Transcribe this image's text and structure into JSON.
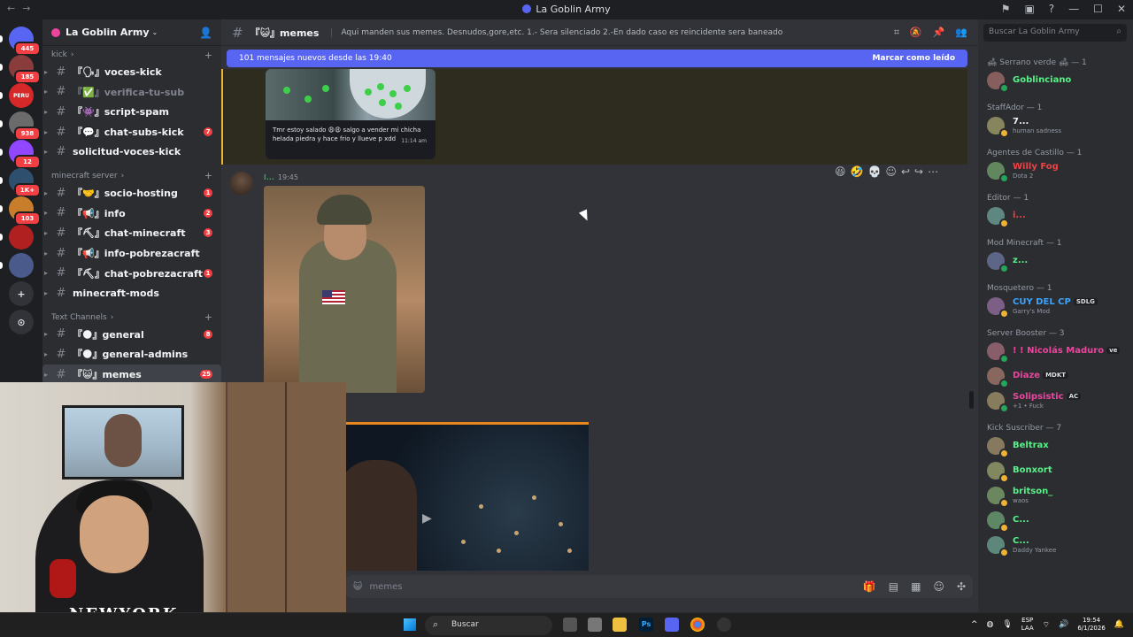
{
  "titlebar": {
    "title": "La Goblin Army",
    "back": "←",
    "forward": "→"
  },
  "guilds": [
    {
      "label": "",
      "badge": "445",
      "color": "#5865f2"
    },
    {
      "label": "",
      "badge": "185",
      "color": "#8a3b3b"
    },
    {
      "label": "PERU",
      "badge": "",
      "color": "#d62828"
    },
    {
      "label": "",
      "badge": "938",
      "color": "#6b6b6b"
    },
    {
      "label": "",
      "badge": "12",
      "color": "#9146ff"
    },
    {
      "label": "",
      "badge": "1K+",
      "color": "#2f4f6f"
    },
    {
      "label": "",
      "badge": "103",
      "color": "#c77d2a"
    },
    {
      "label": "",
      "badge": "",
      "color": "#b02020"
    },
    {
      "label": "",
      "badge": "",
      "color": "#4a5a8a"
    }
  ],
  "server": {
    "name": "La Goblin Army",
    "categories": [
      {
        "name": "kick",
        "channels": [
          {
            "label": "『🗣』voces-kick",
            "count": "",
            "muted": false
          },
          {
            "label": "『✅』verifica-tu-sub",
            "count": "",
            "muted": true
          },
          {
            "label": "『👾』script-spam",
            "count": "",
            "muted": false
          },
          {
            "label": "『💬』chat-subs-kick",
            "count": "7",
            "muted": false
          },
          {
            "label": "solicitud-voces-kick",
            "count": "",
            "muted": false
          }
        ]
      },
      {
        "name": "minecraft server",
        "channels": [
          {
            "label": "『🤝』socio-hosting",
            "count": "1",
            "muted": false
          },
          {
            "label": "『📢』info",
            "count": "2",
            "muted": false
          },
          {
            "label": "『⛏』chat-minecraft",
            "count": "3",
            "muted": false
          },
          {
            "label": "『📢』info-pobrezacraft",
            "count": "",
            "muted": false
          },
          {
            "label": "『⛏』chat-pobrezacraft",
            "count": "1",
            "muted": false
          },
          {
            "label": "minecraft-mods",
            "count": "",
            "muted": false
          }
        ]
      },
      {
        "name": "Text Channels",
        "channels": [
          {
            "label": "『🌑』general",
            "count": "8",
            "muted": false
          },
          {
            "label": "『🌑』general-admins",
            "count": "",
            "muted": false
          },
          {
            "label": "『😺』memes",
            "count": "25",
            "muted": false
          }
        ]
      }
    ]
  },
  "channel": {
    "name": "『😺』memes",
    "topic": "Aqui manden sus memes. Desnudos,gore,etc. 1.- Sera silenciado 2.-En dado caso es reincidente sera baneado",
    "new_messages": "101 mensajes nuevos desde las 19:40",
    "mark_read": "Marcar como leído",
    "caption": "Tmr estoy salado 😩😩 salgo a vender mi chicha helada piedra y hace frio y llueve p xdd",
    "caption_time": "11:14 am",
    "msg_user": "l...",
    "msg_time": "19:45",
    "composer_placeholder": "memes"
  },
  "members_search": "Buscar La Goblin Army",
  "member_groups": [
    {
      "name": "🛋 Serrano verde 🛋 — 1",
      "members": [
        {
          "name": "Goblinciano",
          "sub": "",
          "color": "#57f287",
          "tag": ""
        }
      ]
    },
    {
      "name": "StaffAdor — 1",
      "members": [
        {
          "name": "7...",
          "sub": "human sadness",
          "color": "#f2f3f5",
          "tag": ""
        }
      ]
    },
    {
      "name": "Agentes de Castillo — 1",
      "members": [
        {
          "name": "Willy Fog",
          "sub": "Dota 2",
          "color": "#ed4245",
          "tag": ""
        }
      ]
    },
    {
      "name": "Editor — 1",
      "members": [
        {
          "name": "i...",
          "sub": "",
          "color": "#ed4245",
          "tag": ""
        }
      ]
    },
    {
      "name": "Mod Minecraft — 1",
      "members": [
        {
          "name": "z...",
          "sub": "",
          "color": "#57f287",
          "tag": ""
        }
      ]
    },
    {
      "name": "Mosquetero — 1",
      "members": [
        {
          "name": "CUY DEL CP",
          "sub": "Garry's Mod",
          "color": "#3ba4ff",
          "tag": "SDLG"
        }
      ]
    },
    {
      "name": "Server Booster — 3",
      "members": [
        {
          "name": "! ! Nicolás Maduro",
          "sub": "",
          "color": "#eb459e",
          "tag": "ve"
        },
        {
          "name": "Diaze",
          "sub": "",
          "color": "#eb459e",
          "tag": "MDKT"
        },
        {
          "name": "Solipsistic",
          "sub": "+1 • Fuck",
          "color": "#eb459e",
          "tag": "AC"
        }
      ]
    },
    {
      "name": "Kick Suscriber — 7",
      "members": [
        {
          "name": "Beltrax",
          "sub": "",
          "color": "#57f287",
          "tag": ""
        },
        {
          "name": "Bonxort",
          "sub": "",
          "color": "#57f287",
          "tag": ""
        },
        {
          "name": "britson_",
          "sub": "waos",
          "color": "#57f287",
          "tag": ""
        },
        {
          "name": "C...",
          "sub": "",
          "color": "#57f287",
          "tag": ""
        },
        {
          "name": "C...",
          "sub": "Daddy Yankee",
          "color": "#57f287",
          "tag": ""
        }
      ]
    }
  ],
  "webcam": {
    "shirt_text": "NEWYORK"
  },
  "taskbar": {
    "search": "Buscar",
    "lang1": "ESP",
    "lang2": "LAA",
    "time": "19:54",
    "date": "6/1/2026"
  }
}
